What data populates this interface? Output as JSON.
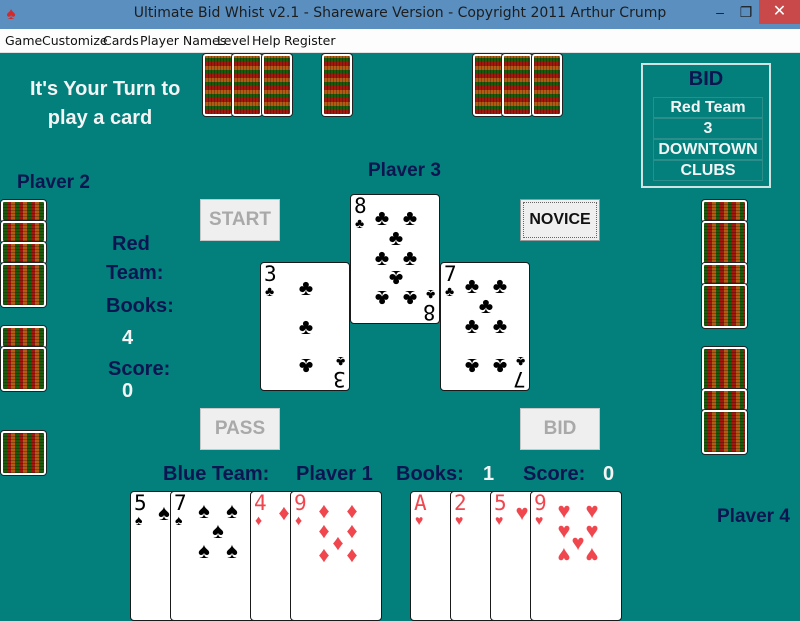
{
  "window": {
    "title": "Ultimate Bid Whist v2.1 - Shareware Version - Copyright 2011 Arthur Crump",
    "app_icon": "spade-icon",
    "controls": {
      "minimize": "–",
      "maximize": "❐",
      "close": "✕"
    }
  },
  "menu": [
    "Game",
    "Customize",
    "Cards",
    "Player Names",
    "Level",
    "Help",
    "Register"
  ],
  "status_message": [
    "It's Your Turn to",
    "play a card"
  ],
  "bid": {
    "title": "BID",
    "rows": [
      "Red Team",
      "3",
      "DOWNTOWN",
      "CLUBS"
    ]
  },
  "players": {
    "p1": "Plaver 1",
    "p2": "Plaver 2",
    "p3": "Plaver 3",
    "p4": "Plaver 4"
  },
  "red_team": {
    "label_line1": "Red",
    "label_line2": "Team:",
    "books_label": "Books:",
    "books": "4",
    "score_label": "Score:",
    "score": "0"
  },
  "blue_team": {
    "label": "Blue Team:",
    "books_label": "Books:",
    "books": "1",
    "score_label": "Score:",
    "score": "0"
  },
  "buttons": {
    "start": "START",
    "novice": "NOVICE",
    "pass": "PASS",
    "bid": "BID"
  },
  "played_cards": [
    {
      "player": "Plaver 2",
      "rank": "3",
      "suit": "♣",
      "color": "black"
    },
    {
      "player": "Plaver 3",
      "rank": "8",
      "suit": "♣",
      "color": "black"
    },
    {
      "player": "Plaver 4",
      "rank": "7",
      "suit": "♣",
      "color": "black"
    }
  ],
  "hand": [
    {
      "rank": "5",
      "suit": "♠",
      "color": "black"
    },
    {
      "rank": "7",
      "suit": "♠",
      "color": "black"
    },
    {
      "rank": "4",
      "suit": "♦",
      "color": "red"
    },
    {
      "rank": "9",
      "suit": "♦",
      "color": "red"
    },
    {
      "rank": "A",
      "suit": "♥",
      "color": "red"
    },
    {
      "rank": "2",
      "suit": "♥",
      "color": "red"
    },
    {
      "rank": "5",
      "suit": "♥",
      "color": "red"
    },
    {
      "rank": "9",
      "suit": "♥",
      "color": "red"
    }
  ],
  "opponent_card_counts": {
    "p2": 7,
    "p3": 7,
    "p4": 7
  },
  "colors": {
    "felt": "#037f7c",
    "navy_text": "#0b1650",
    "titlebar": "#5a8fc0",
    "close": "#c9494a",
    "red_suit": "#f0474f"
  }
}
